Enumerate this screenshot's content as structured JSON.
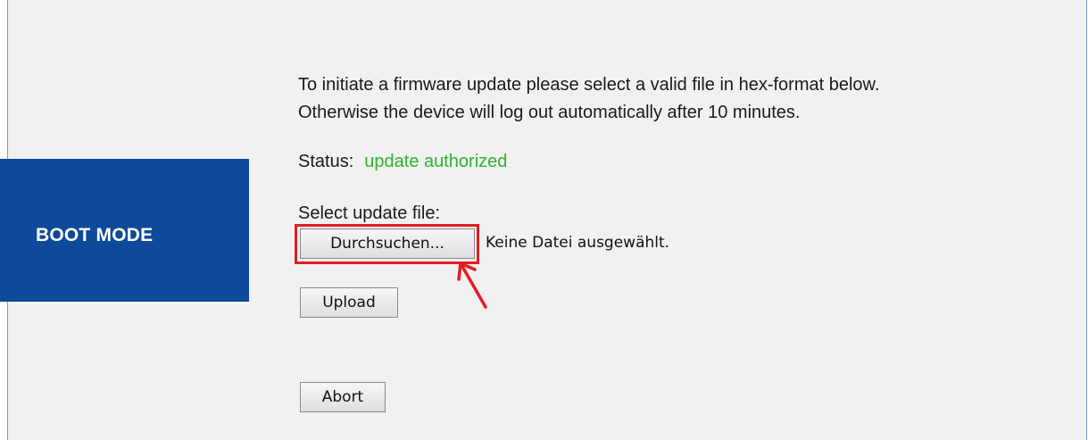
{
  "sidebar": {
    "label": "BOOT MODE"
  },
  "main": {
    "intro_line1": "To initiate a firmware update please select a valid file in hex-format below.",
    "intro_line2": "Otherwise the device will log out automatically after 10 minutes.",
    "status_label": "Status:",
    "status_value": "update authorized",
    "select_label": "Select update file:",
    "browse_button": "Durchsuchen...",
    "no_file_text": "Keine Datei ausgewählt.",
    "upload_button": "Upload",
    "abort_button": "Abort"
  },
  "colors": {
    "sidebar_bg": "#0e4a9a",
    "status_ok": "#2bb52b",
    "highlight": "#e31c24"
  }
}
